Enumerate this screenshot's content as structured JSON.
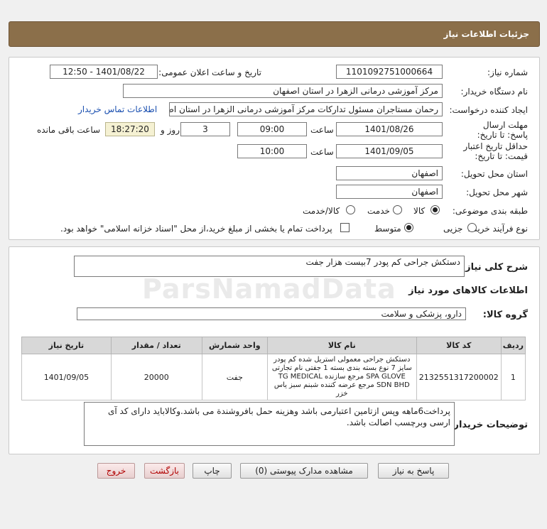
{
  "header": {
    "title": "جزئیات اطلاعات نیاز"
  },
  "info": {
    "need_number_label": "شماره نیاز:",
    "need_number": "1101092751000664",
    "announce_label": "تاریخ و ساعت اعلان عمومی:",
    "announce_value": "1401/08/22 - 12:50",
    "buyer_label": "نام دستگاه خریدار:",
    "buyer_value": "مرکز آموزشی درمانی الزهرا در استان اصفهان",
    "requester_label": "ایجاد کننده درخواست:",
    "requester_value": "رحمان مستاجران مسئول تدارکات مرکز آموزشی درمانی الزهرا در استان اصفهان",
    "contact_link": "اطلاعات تماس خریدار",
    "deadline_label": "مهلت ارسال پاسخ: تا تاریخ:",
    "deadline_date": "1401/08/26",
    "time_label": "ساعت",
    "deadline_time": "09:00",
    "days_value": "3",
    "days_label": "روز و",
    "remaining_time": "18:27:20",
    "remaining_label": "ساعت باقی مانده",
    "validity_label": "حداقل تاریخ اعتبار قیمت: تا تاریخ:",
    "validity_date": "1401/09/05",
    "validity_time_label": "ساعت",
    "validity_time": "10:00",
    "province_label": "استان محل تحویل:",
    "province_value": "اصفهان",
    "city_label": "شهر محل تحویل:",
    "city_value": "اصفهان",
    "category_label": "طبقه بندی موضوعی:",
    "category_options": [
      "کالا",
      "خدمت",
      "کالا/خدمت"
    ],
    "purchase_label": "نوع فرآیند خرید :",
    "purchase_options": [
      "جزیی",
      "متوسط"
    ],
    "payment_note": "پرداخت تمام یا بخشی از مبلغ خرید،از محل \"اسناد خزانه اسلامی\" خواهد بود."
  },
  "details": {
    "general_desc_label": "شرح کلی نیاز:",
    "general_desc_value": "دستکش جراحی کم پودر 7بیست هزار جفت",
    "goods_info_title": "اطلاعات کالاهای مورد نیاز",
    "goods_group_label": "گروه کالا:",
    "goods_group_value": "دارو، پزشکی و سلامت",
    "table_headers": [
      "ردیف",
      "کد کالا",
      "نام کالا",
      "واحد شمارش",
      "تعداد / مقدار",
      "تاریخ نیاز"
    ],
    "rows": [
      {
        "index": "1",
        "code": "2132551317200002",
        "name": "دستکش جراحی معمولی استریل شده کم پودر سایز 7 نوع بسته بندی بسته 1 جفتی نام تجارتی SPA GLOVE مرجع سازنده TG MEDICAL SDN BHD مرجع عرضه کننده شبنم سبز یاس خزر",
        "unit": "جفت",
        "qty": "20000",
        "date": "1401/09/05"
      }
    ],
    "buyer_notes_label": "توضیحات خریدار:",
    "buyer_notes_value": "پرداخت6ماهه وپس ازتامین اعتبارمی باشد وهزینه حمل بافروشندة می باشد.وکالاباید دارای کد آی ارسی وبرچسب اصالت باشد."
  },
  "buttons": {
    "reply": "پاسخ به نیاز",
    "attachments": "مشاهده مدارک پیوستی (0)",
    "print": "چاپ",
    "back": "بازگشت",
    "exit": "خروج"
  },
  "watermark": "ParsNamadData"
}
